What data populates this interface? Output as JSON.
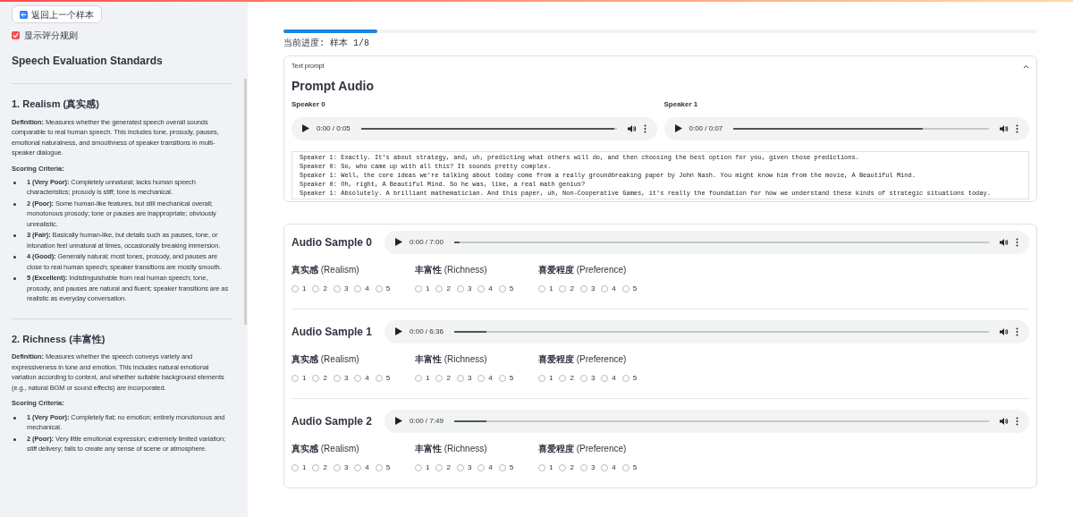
{
  "sidebar": {
    "back_button": "返回上一个样本",
    "show_rules": {
      "label": "显示评分规则",
      "checked": true
    },
    "title": "Speech Evaluation Standards",
    "sections": [
      {
        "heading": "1. Realism (真实感)",
        "definition": "**Definition:** Measures whether the generated speech overall sounds comparable to real human speech. This includes tone, prosody, pauses, emotional naturalness, and smoothness of speaker transitions in multi-speaker dialogue.",
        "criteria_label": "Scoring Criteria:",
        "criteria": [
          "**1 (Very Poor):** Completely unnatural; lacks human speech characteristics; prosody is stiff; tone is mechanical.",
          "**2 (Poor):** Some human-like features, but still mechanical overall; monotonous prosody; tone or pauses are inappropriate; obviously unrealistic.",
          "**3 (Fair):** Basically human-like, but details such as pauses, tone, or intonation feel unnatural at times, occasionally breaking immersion.",
          "**4 (Good):** Generally natural; most tones, prosody, and pauses are close to real human speech; speaker transitions are mostly smooth.",
          "**5 (Excellent):** Indistinguishable from real human speech; tone, prosody, and pauses are natural and fluent; speaker transitions are as realistic as everyday conversation."
        ]
      },
      {
        "heading": "2. Richness (丰富性)",
        "definition": "**Definition:** Measures whether the speech conveys variety and expressiveness in tone and emotion. This includes natural emotional variation according to context, and whether suitable background elements (e.g., natural BGM or sound effects) are incorporated.",
        "criteria_label": "Scoring Criteria:",
        "criteria": [
          "**1 (Very Poor):** Completely flat; no emotion; entirely monotonous and mechanical.",
          "**2 (Poor):** Very little emotional expression; extremely limited variation; stiff delivery; fails to create any sense of scene or atmosphere."
        ]
      }
    ]
  },
  "progress": {
    "level": 0.125,
    "label": "当前进度: 样本 1/8"
  },
  "prompt_panel": {
    "label": "Text prompt",
    "expanded": true,
    "title": "Prompt Audio",
    "speakers": [
      {
        "label": "Speaker 0",
        "time": "0:00 / 0:05",
        "level": 0.99
      },
      {
        "label": "Speaker 1",
        "time": "0:00 / 0:07",
        "level": 0.74
      }
    ],
    "transcript": [
      "Speaker 1: Exactly. It's about strategy, and, uh, predicting what others will do, and then choosing the best option for you, given those predictions.",
      "Speaker 0: So, who came up with all this? It sounds pretty complex.",
      "Speaker 1: Well, the core ideas we're talking about today come from a really groundbreaking paper by John Nash. You might know him from the movie, A Beautiful Mind.",
      "Speaker 0: Oh, right, A Beautiful Mind. So he was, like, a real math genius?",
      "Speaker 1: Absolutely. A brilliant mathematician. And this paper, uh, Non-Cooperative Games, it's really the foundation for how we understand these kinds of strategic situations today."
    ]
  },
  "samples": [
    {
      "title": "Audio Sample 0",
      "time": "0:00 / 7:00",
      "level": 0.01,
      "ratings": [
        {
          "label": "**真实感** (Realism)",
          "options": [
            {
              "label": "1",
              "selected": false
            },
            {
              "label": "2",
              "selected": false
            },
            {
              "label": "3",
              "selected": false
            },
            {
              "label": "4",
              "selected": false
            },
            {
              "label": "5",
              "selected": false
            }
          ]
        },
        {
          "label": "**丰富性** (Richness)",
          "options": [
            {
              "label": "1",
              "selected": false
            },
            {
              "label": "2",
              "selected": false
            },
            {
              "label": "3",
              "selected": false
            },
            {
              "label": "4",
              "selected": false
            },
            {
              "label": "5",
              "selected": false
            }
          ]
        },
        {
          "label": "**喜爱程度** (Preference)",
          "options": [
            {
              "label": "1",
              "selected": false
            },
            {
              "label": "2",
              "selected": false
            },
            {
              "label": "3",
              "selected": false
            },
            {
              "label": "4",
              "selected": false
            },
            {
              "label": "5",
              "selected": false
            }
          ]
        }
      ]
    },
    {
      "title": "Audio Sample 1",
      "time": "0:00 / 6:36",
      "level": 0.06,
      "ratings": [
        {
          "label": "**真实感** (Realism)",
          "options": [
            {
              "label": "1",
              "selected": false
            },
            {
              "label": "2",
              "selected": false
            },
            {
              "label": "3",
              "selected": false
            },
            {
              "label": "4",
              "selected": false
            },
            {
              "label": "5",
              "selected": false
            }
          ]
        },
        {
          "label": "**丰富性** (Richness)",
          "options": [
            {
              "label": "1",
              "selected": false
            },
            {
              "label": "2",
              "selected": false
            },
            {
              "label": "3",
              "selected": false
            },
            {
              "label": "4",
              "selected": false
            },
            {
              "label": "5",
              "selected": false
            }
          ]
        },
        {
          "label": "**喜爱程度** (Preference)",
          "options": [
            {
              "label": "1",
              "selected": false
            },
            {
              "label": "2",
              "selected": false
            },
            {
              "label": "3",
              "selected": false
            },
            {
              "label": "4",
              "selected": false
            },
            {
              "label": "5",
              "selected": false
            }
          ]
        }
      ]
    },
    {
      "title": "Audio Sample 2",
      "time": "0:00 / 7:49",
      "level": 0.06,
      "ratings": [
        {
          "label": "**真实感** (Realism)",
          "options": [
            {
              "label": "1",
              "selected": false
            },
            {
              "label": "2",
              "selected": false
            },
            {
              "label": "3",
              "selected": false
            },
            {
              "label": "4",
              "selected": false
            },
            {
              "label": "5",
              "selected": false
            }
          ]
        },
        {
          "label": "**丰富性** (Richness)",
          "options": [
            {
              "label": "1",
              "selected": false
            },
            {
              "label": "2",
              "selected": false
            },
            {
              "label": "3",
              "selected": false
            },
            {
              "label": "4",
              "selected": false
            },
            {
              "label": "5",
              "selected": false
            }
          ]
        },
        {
          "label": "**喜爱程度** (Preference)",
          "options": [
            {
              "label": "1",
              "selected": false
            },
            {
              "label": "2",
              "selected": false
            },
            {
              "label": "3",
              "selected": false
            },
            {
              "label": "4",
              "selected": false
            },
            {
              "label": "5",
              "selected": false
            }
          ]
        }
      ]
    }
  ]
}
